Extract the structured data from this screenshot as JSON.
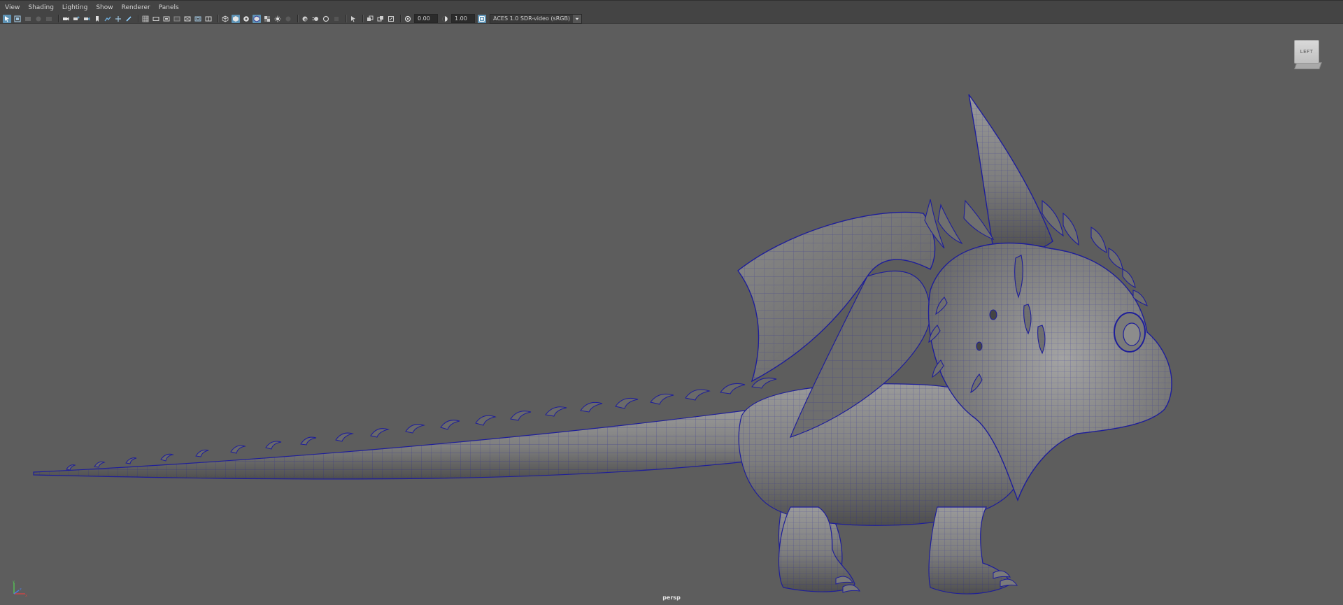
{
  "menu": {
    "items": [
      "View",
      "Shading",
      "Lighting",
      "Show",
      "Renderer",
      "Panels"
    ]
  },
  "toolbar": {
    "exposure_value": "0.00",
    "gamma_value": "1.00",
    "color_space": "ACES 1.0 SDR-video (sRGB)",
    "icons": [
      "select-camera-icon",
      "camera-attributes-icon",
      "bookmarks-icon",
      "image-plane-icon",
      "2d-pan-zoom-icon",
      "grease-pencil-icon",
      "grid-icon",
      "film-gate-icon",
      "resolution-gate-icon",
      "gate-mask-icon",
      "field-chart-icon",
      "safe-action-icon",
      "safe-title-icon",
      "wireframe-icon",
      "smooth-shade-icon",
      "wireframe-on-shaded-icon",
      "textured-icon",
      "use-all-lights-icon",
      "shadows-icon",
      "screen-space-ao-icon",
      "motion-blur-icon",
      "multisample-aa-icon",
      "depth-of-field-icon",
      "isolate-select-icon",
      "xray-icon",
      "xray-joints-icon",
      "xray-components-icon",
      "exposure-icon",
      "gamma-icon",
      "color-management-icon"
    ],
    "accent": "#5e93b5"
  },
  "viewport": {
    "background": "#5d5d5d",
    "viewcube_label": "LEFT",
    "camera_label": "persp",
    "wire_color": "#1e1e9a"
  }
}
